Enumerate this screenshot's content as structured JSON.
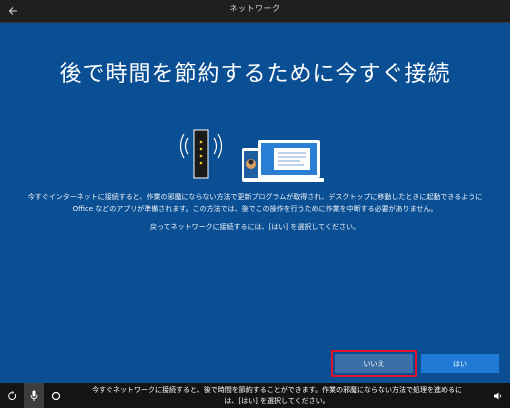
{
  "window": {
    "title": "ネットワーク"
  },
  "page": {
    "heading": "後で時間を節約するために今すぐ接続",
    "description_line1": "今すぐインターネットに接続すると、作業の邪魔にならない方法で更新プログラムが取得され、デスクトップに移動したときに起動できるように",
    "description_line2": "Office などのアプリが準備されます。この方法では、後でこの操作を行うために作業を中断する必要がありません。",
    "instruction": "戻ってネットワークに接続するには、[はい] を選択してください。"
  },
  "buttons": {
    "no_label": "いいえ",
    "yes_label": "はい"
  },
  "taskbar": {
    "caption_line1": "今すぐネットワークに接続すると、後で時間を節約することができます。作業の邪魔にならない方法で処理を進めるに",
    "caption_line2": "は、[はい] を選択してください。",
    "icons": [
      "ease-of-access-icon",
      "microphone-icon",
      "cortana-icon",
      "volume-icon"
    ]
  },
  "colors": {
    "background": "#0a4f94",
    "primary_button": "#1e7ad4",
    "secondary_button": "#3a6fa6",
    "highlight_outline": "#e0112b"
  }
}
